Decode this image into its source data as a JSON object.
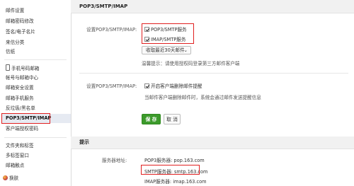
{
  "sidebar": {
    "items": [
      {
        "label": "邮件设置"
      },
      {
        "label": "邮箱密码修改"
      },
      {
        "label": "签名/电子名片"
      },
      {
        "label": "来信分类"
      },
      {
        "label": "信纸"
      },
      {
        "label": "手机号码邮箱"
      },
      {
        "label": "帐号与邮箱中心"
      },
      {
        "label": "邮箱安全设置"
      },
      {
        "label": "邮箱手机服务"
      },
      {
        "label": "反垃圾/黑名单"
      },
      {
        "label": "POP3/SMTP/IMAP"
      },
      {
        "label": "客户端授权密码"
      },
      {
        "label": "文件夹和标签"
      },
      {
        "label": "多标签窗口"
      },
      {
        "label": "邮箱触点"
      },
      {
        "label": "换肤"
      }
    ]
  },
  "section1": {
    "title": "POP3/SMTP/IMAP",
    "setting_label": "设置POP3/SMTP/IMAP:",
    "pop3_label": "POP3/SMTP服务",
    "imap_label": "IMAP/SMTP服务",
    "select_value": "收取最近30天邮件",
    "tip": "温馨提示：请使用授权码登录第三方邮件客户端",
    "delete_label": "设置POP3/SMTP/IMAP:",
    "delete_checkbox": "开启客户端删除邮件提醒",
    "delete_hint": "当邮件客户端删除邮件时，系统会通过邮件发送提醒信息",
    "save": "保 存",
    "cancel": "取 消"
  },
  "section2": {
    "title": "提示",
    "server_label": "服务器地址:",
    "pop3_server": "POP3服务器: pop.163.com",
    "smtp_server": "SMTP服务器: smtp.163.com",
    "imap_server": "IMAP服务器: imap.163.com"
  },
  "colors": {
    "highlight": "#e02020",
    "save_button": "#3c9a2b",
    "active_item_bg": "#e6eaf2"
  }
}
